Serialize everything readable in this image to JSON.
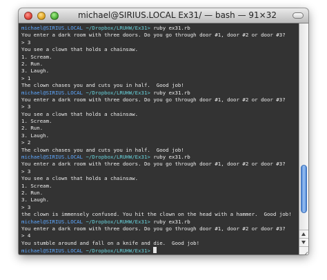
{
  "window": {
    "title": "michael@SIRIUS.LOCAL  Ex31/ — bash — 91×32"
  },
  "terminal": {
    "prompt_user": "michael@SIRIUS.LOCAL",
    "prompt_path": "~/Dropbox/LRUHW/Ex31>",
    "lines": [
      {
        "type": "prompt",
        "cmd": " ruby ex31.rb"
      },
      {
        "type": "text",
        "text": "You enter a dark room with three doors. Do you go through door #1, door #2 or door #3?"
      },
      {
        "type": "text",
        "text": "> 3"
      },
      {
        "type": "text",
        "text": "You see a clown that holds a chainsaw."
      },
      {
        "type": "text",
        "text": "1. Scream."
      },
      {
        "type": "text",
        "text": "2. Run."
      },
      {
        "type": "text",
        "text": "3. Laugh."
      },
      {
        "type": "text",
        "text": "> 1"
      },
      {
        "type": "text",
        "text": "The clown chases you and cuts you in half.  Good job!"
      },
      {
        "type": "prompt",
        "cmd": " ruby ex31.rb"
      },
      {
        "type": "text",
        "text": "You enter a dark room with three doors. Do you go through door #1, door #2 or door #3?"
      },
      {
        "type": "text",
        "text": "> 3"
      },
      {
        "type": "text",
        "text": "You see a clown that holds a chainsaw."
      },
      {
        "type": "text",
        "text": "1. Scream."
      },
      {
        "type": "text",
        "text": "2. Run."
      },
      {
        "type": "text",
        "text": "3. Laugh."
      },
      {
        "type": "text",
        "text": "> 2"
      },
      {
        "type": "text",
        "text": "The clown chases you and cuts you in half.  Good job!"
      },
      {
        "type": "prompt",
        "cmd": " ruby ex31.rb"
      },
      {
        "type": "text",
        "text": "You enter a dark room with three doors. Do you go through door #1, door #2 or door #3?"
      },
      {
        "type": "text",
        "text": "> 3"
      },
      {
        "type": "text",
        "text": "You see a clown that holds a chainsaw."
      },
      {
        "type": "text",
        "text": "1. Scream."
      },
      {
        "type": "text",
        "text": "2. Run."
      },
      {
        "type": "text",
        "text": "3. Laugh."
      },
      {
        "type": "text",
        "text": "> 3"
      },
      {
        "type": "text",
        "text": "the clown is immensely confused. You hit the clown on the head with a hammer.  Good job!"
      },
      {
        "type": "prompt",
        "cmd": " ruby ex31.rb"
      },
      {
        "type": "text",
        "text": "You enter a dark room with three doors. Do you go through door #1, door #2 or door #3?"
      },
      {
        "type": "text",
        "text": "> 4"
      },
      {
        "type": "text",
        "text": "You stumble around and fall on a knife and die.  Good job!"
      },
      {
        "type": "prompt",
        "cmd": " ",
        "cursor": true
      }
    ]
  },
  "colors": {
    "background": "#333333",
    "text": "#efefef",
    "prompt_user": "#5ea8ff",
    "prompt_path": "#68d3dc",
    "scroll_thumb": "#6a9be0"
  },
  "icons": {
    "close": "close-icon",
    "minimize": "minimize-icon",
    "zoom": "zoom-icon",
    "toolbar_toggle": "toolbar-toggle-icon"
  }
}
